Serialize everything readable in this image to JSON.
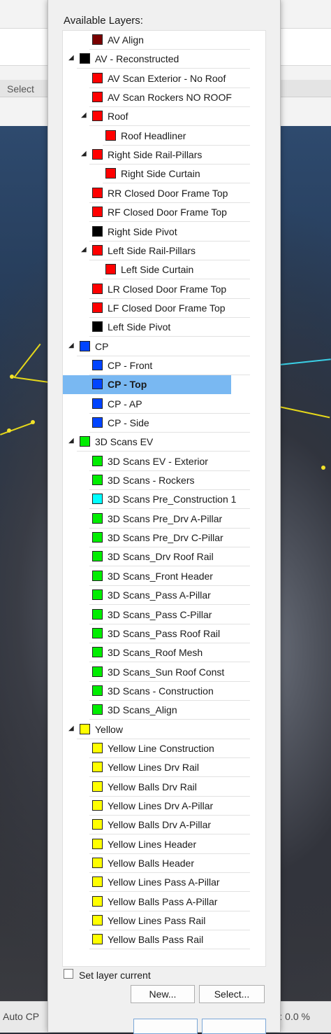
{
  "background_app": {
    "select_label": "Select",
    "status_left": "Auto CP",
    "status_right": ": 0.0 %"
  },
  "dialog": {
    "title": "Available Layers:",
    "set_layer_current_label": "Set layer current",
    "set_layer_current_checked": false,
    "new_button": "New...",
    "select_button": "Select..."
  },
  "layers": [
    {
      "name": "AV Align",
      "color": "#7a0000",
      "level": 1,
      "expanded": null
    },
    {
      "name": "AV - Reconstructed",
      "color": "#000000",
      "level": 0,
      "expanded": true
    },
    {
      "name": "AV Scan Exterior - No Roof",
      "color": "#ff0000",
      "level": 1,
      "expanded": null
    },
    {
      "name": "AV Scan Rockers NO ROOF",
      "color": "#ff0000",
      "level": 1,
      "expanded": null
    },
    {
      "name": "Roof",
      "color": "#ff0000",
      "level": 1,
      "expanded": true
    },
    {
      "name": "Roof Headliner",
      "color": "#ff0000",
      "level": 2,
      "expanded": null
    },
    {
      "name": "Right Side Rail-Pillars",
      "color": "#ff0000",
      "level": 1,
      "expanded": true
    },
    {
      "name": "Right Side Curtain",
      "color": "#ff0000",
      "level": 2,
      "expanded": null
    },
    {
      "name": "RR Closed Door Frame Top",
      "color": "#ff0000",
      "level": 1,
      "expanded": null
    },
    {
      "name": "RF Closed Door Frame Top",
      "color": "#ff0000",
      "level": 1,
      "expanded": null
    },
    {
      "name": "Right Side Pivot",
      "color": "#000000",
      "level": 1,
      "expanded": null
    },
    {
      "name": "Left Side Rail-Pillars",
      "color": "#ff0000",
      "level": 1,
      "expanded": true
    },
    {
      "name": "Left Side Curtain",
      "color": "#ff0000",
      "level": 2,
      "expanded": null
    },
    {
      "name": "LR Closed Door Frame Top",
      "color": "#ff0000",
      "level": 1,
      "expanded": null
    },
    {
      "name": "LF Closed Door Frame Top",
      "color": "#ff0000",
      "level": 1,
      "expanded": null
    },
    {
      "name": "Left Side Pivot",
      "color": "#000000",
      "level": 1,
      "expanded": null
    },
    {
      "name": "CP",
      "color": "#0044ff",
      "level": 0,
      "expanded": true
    },
    {
      "name": "CP - Front",
      "color": "#0044ff",
      "level": 1,
      "expanded": null
    },
    {
      "name": "CP - Top",
      "color": "#0044ff",
      "level": 1,
      "expanded": null,
      "selected": true
    },
    {
      "name": "CP - AP",
      "color": "#0044ff",
      "level": 1,
      "expanded": null
    },
    {
      "name": "CP - Side",
      "color": "#0044ff",
      "level": 1,
      "expanded": null
    },
    {
      "name": "3D Scans EV",
      "color": "#00ee00",
      "level": 0,
      "expanded": true
    },
    {
      "name": "3D Scans EV - Exterior",
      "color": "#00ee00",
      "level": 1,
      "expanded": null
    },
    {
      "name": "3D Scans - Rockers",
      "color": "#00ee00",
      "level": 1,
      "expanded": null
    },
    {
      "name": "3D Scans Pre_Construction 1",
      "color": "#00ffff",
      "level": 1,
      "expanded": null
    },
    {
      "name": "3D Scans Pre_Drv A-Pillar",
      "color": "#00ee00",
      "level": 1,
      "expanded": null
    },
    {
      "name": "3D Scans Pre_Drv C-Pillar",
      "color": "#00ee00",
      "level": 1,
      "expanded": null
    },
    {
      "name": "3D Scans_Drv Roof Rail",
      "color": "#00ee00",
      "level": 1,
      "expanded": null
    },
    {
      "name": "3D Scans_Front Header",
      "color": "#00ee00",
      "level": 1,
      "expanded": null
    },
    {
      "name": "3D Scans_Pass A-Pillar",
      "color": "#00ee00",
      "level": 1,
      "expanded": null
    },
    {
      "name": "3D Scans_Pass C-Pillar",
      "color": "#00ee00",
      "level": 1,
      "expanded": null
    },
    {
      "name": "3D Scans_Pass Roof Rail",
      "color": "#00ee00",
      "level": 1,
      "expanded": null
    },
    {
      "name": "3D Scans_Roof Mesh",
      "color": "#00ee00",
      "level": 1,
      "expanded": null
    },
    {
      "name": "3D Scans_Sun Roof Const",
      "color": "#00ee00",
      "level": 1,
      "expanded": null
    },
    {
      "name": "3D Scans - Construction",
      "color": "#00ee00",
      "level": 1,
      "expanded": null
    },
    {
      "name": "3D Scans_Align",
      "color": "#00ee00",
      "level": 1,
      "expanded": null
    },
    {
      "name": "Yellow",
      "color": "#ffff00",
      "level": 0,
      "expanded": true
    },
    {
      "name": "Yellow Line Construction",
      "color": "#ffff00",
      "level": 1,
      "expanded": null
    },
    {
      "name": "Yellow Lines Drv Rail",
      "color": "#ffff00",
      "level": 1,
      "expanded": null
    },
    {
      "name": "Yellow Balls Drv Rail",
      "color": "#ffff00",
      "level": 1,
      "expanded": null
    },
    {
      "name": "Yellow Lines Drv A-Pillar",
      "color": "#ffff00",
      "level": 1,
      "expanded": null
    },
    {
      "name": "Yellow Balls Drv A-Pillar",
      "color": "#ffff00",
      "level": 1,
      "expanded": null
    },
    {
      "name": "Yellow Lines Header",
      "color": "#ffff00",
      "level": 1,
      "expanded": null
    },
    {
      "name": "Yellow Balls Header",
      "color": "#ffff00",
      "level": 1,
      "expanded": null
    },
    {
      "name": "Yellow Lines Pass A-Pillar",
      "color": "#ffff00",
      "level": 1,
      "expanded": null
    },
    {
      "name": "Yellow Balls Pass A-Pillar",
      "color": "#ffff00",
      "level": 1,
      "expanded": null
    },
    {
      "name": "Yellow Lines Pass Rail",
      "color": "#ffff00",
      "level": 1,
      "expanded": null
    },
    {
      "name": "Yellow Balls Pass Rail",
      "color": "#ffff00",
      "level": 1,
      "expanded": null
    }
  ],
  "selection_color": "#79b8f2"
}
